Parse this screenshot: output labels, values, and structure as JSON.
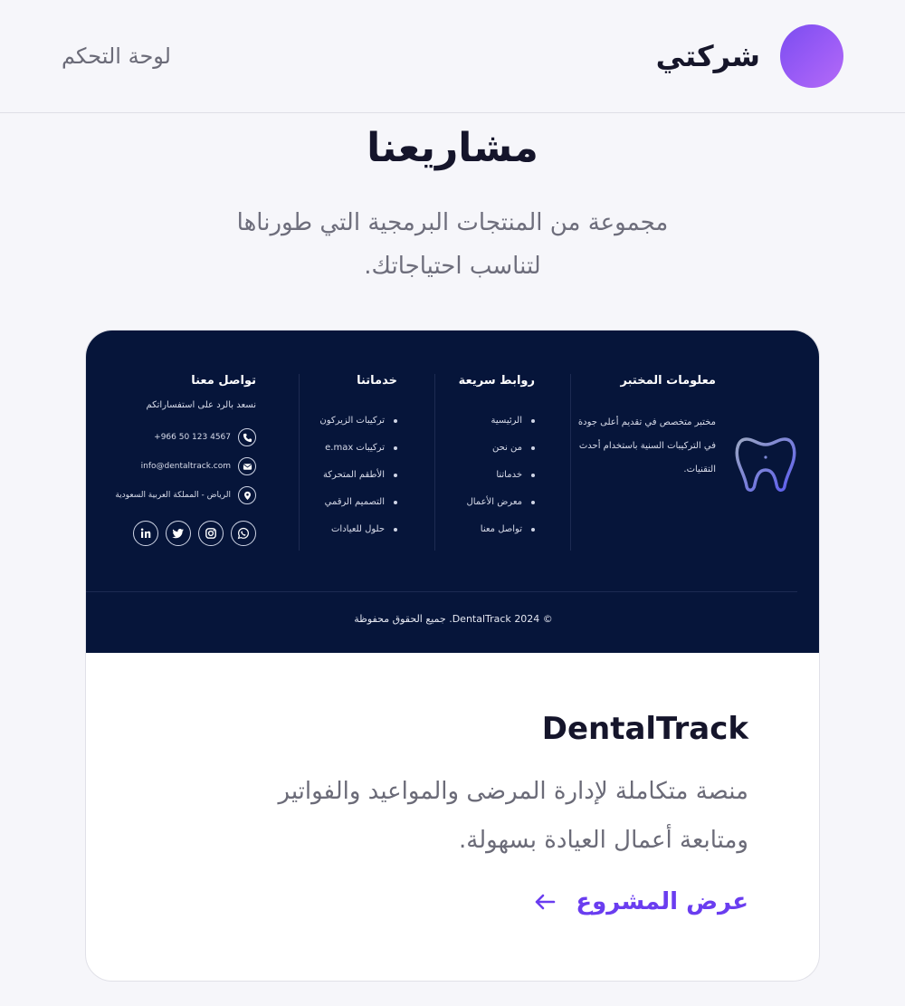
{
  "header": {
    "brand_name": "شركتي",
    "dashboard_link": "لوحة التحكم"
  },
  "section": {
    "title": "مشاريعنا",
    "subtitle": "مجموعة من المنتجات البرمجية التي طورناها لتناسب احتياجاتك."
  },
  "preview": {
    "lab": {
      "heading": "معلومات المختبر",
      "text": "مختبر متخصص في تقديم أعلى جودة في التركيبات السنية باستخدام أحدث التقنيات."
    },
    "links": {
      "heading": "روابط سريعة",
      "items": [
        "الرئيسية",
        "من نحن",
        "خدماتنا",
        "معرض الأعمال",
        "تواصل معنا"
      ]
    },
    "services": {
      "heading": "خدماتنا",
      "items": [
        "تركيبات الزيركون",
        "تركيبات e.max",
        "الأطقم المتحركة",
        "التصميم الرقمي",
        "حلول للعيادات"
      ]
    },
    "contact": {
      "heading": "تواصل معنا",
      "note": "نسعد بالرد على استفساراتكم",
      "phone": "+966 50 123 4567",
      "email": "info@dentaltrack.com",
      "address": "الرياض - المملكة العربية السعودية"
    },
    "copyright": "© 2024 DentalTrack. جميع الحقوق محفوظة"
  },
  "project": {
    "title": "DentalTrack",
    "description": "منصة متكاملة لإدارة المرضى والمواعيد والفواتير ومتابعة أعمال العيادة بسهولة.",
    "link_label": "عرض المشروع"
  },
  "colors": {
    "accent": "#6a3df0",
    "footer_bg": "#06153a",
    "page_bg": "#f6f6fa"
  }
}
